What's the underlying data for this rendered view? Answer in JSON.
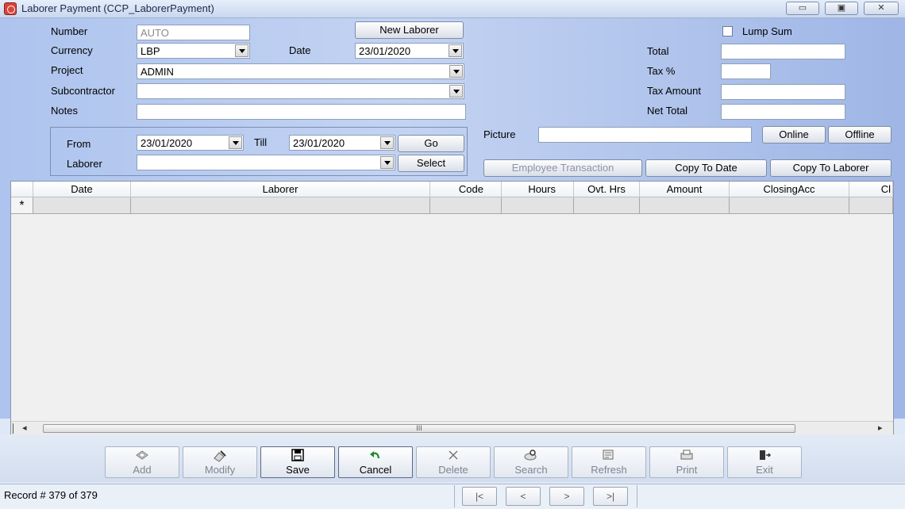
{
  "window": {
    "title": "Laborer Payment  (CCP_LaborerPayment)",
    "minimize_glyph": "▭",
    "maximize_glyph": "▣",
    "close_glyph": "✕"
  },
  "form": {
    "number_label": "Number",
    "number_value": "AUTO",
    "new_laborer_label": "New Laborer",
    "currency_label": "Currency",
    "currency_value": "LBP",
    "date_label": "Date",
    "date_value": "23/01/2020",
    "project_label": "Project",
    "project_value": "ADMIN",
    "subcontractor_label": "Subcontractor",
    "subcontractor_value": "",
    "notes_label": "Notes",
    "notes_value": "",
    "lump_sum_label": "Lump Sum",
    "total_label": "Total",
    "total_value": "",
    "tax_pct_label": "Tax %",
    "tax_pct_value": "",
    "tax_amount_label": "Tax Amount",
    "tax_amount_value": "",
    "net_total_label": "Net Total",
    "net_total_value": ""
  },
  "range": {
    "from_label": "From",
    "from_value": "23/01/2020",
    "till_label": "Till",
    "till_value": "23/01/2020",
    "go_label": "Go",
    "laborer_label": "Laborer",
    "laborer_value": "",
    "select_label": "Select"
  },
  "picture": {
    "label": "Picture",
    "value": "",
    "online_label": "Online",
    "offline_label": "Offline",
    "employee_transaction_label": "Employee Transaction",
    "copy_to_date_label": "Copy To Date",
    "copy_to_laborer_label": "Copy To Laborer"
  },
  "grid": {
    "columns": [
      "Date",
      "Laborer",
      "Code",
      "Hours",
      "Ovt. Hrs",
      "Amount",
      "ClosingAcc",
      "Cl"
    ],
    "new_row_marker": "*",
    "scroll_thumb_grip": "III",
    "scroll_left_glyph": "◂",
    "scroll_right_glyph": "▸"
  },
  "toolbar": {
    "add": "Add",
    "modify": "Modify",
    "save": "Save",
    "cancel": "Cancel",
    "delete": "Delete",
    "search": "Search",
    "refresh": "Refresh",
    "print": "Print",
    "exit": "Exit",
    "icons": {
      "add": "add-icon",
      "modify": "modify-icon",
      "save": "floppy-disk-icon",
      "cancel": "undo-arrow-icon",
      "delete": "x-icon",
      "search": "search-icon",
      "refresh": "refresh-icon",
      "print": "printer-icon",
      "exit": "exit-door-icon"
    }
  },
  "status": {
    "record_text": "Record #  379 of 379",
    "nav_first": "|<",
    "nav_prev": "<",
    "nav_next": ">",
    "nav_last": ">|"
  }
}
